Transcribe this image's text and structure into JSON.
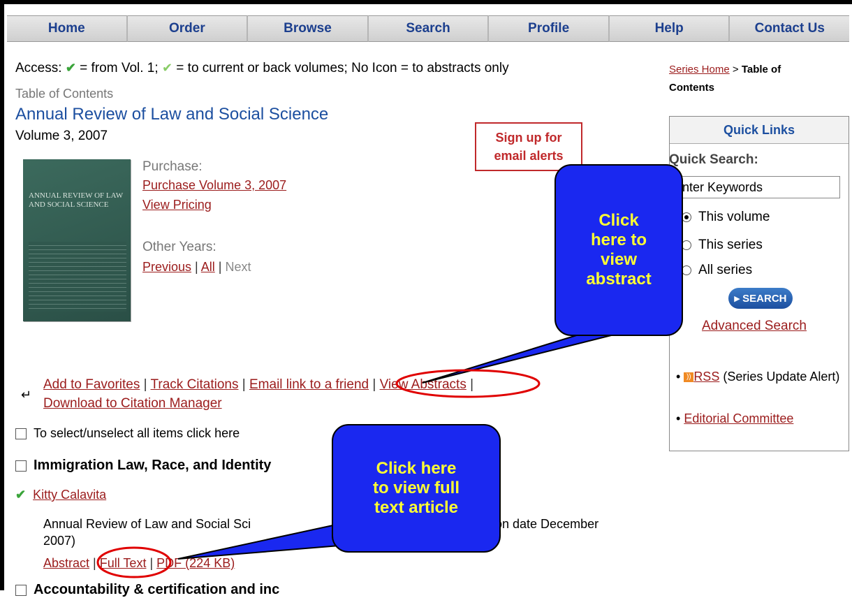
{
  "nav": {
    "items": [
      "Home",
      "Order",
      "Browse",
      "Search",
      "Profile",
      "Help",
      "Contact Us"
    ]
  },
  "access": {
    "prefix": "Access:",
    "check_full": "✔",
    "check_partial": "✔",
    "text1": " = from Vol. 1; ",
    "text2": " = to current or back volumes; No Icon = to abstracts only"
  },
  "page": {
    "toc_label": "Table of Contents",
    "series_title": "Annual Review of Law and Social Science",
    "volume": "Volume 3, 2007",
    "cover_title": "ANNUAL REVIEW OF LAW AND SOCIAL SCIENCE"
  },
  "purchase": {
    "heading": "Purchase:",
    "link1": "Purchase Volume 3, 2007",
    "link2": "View Pricing"
  },
  "other_years": {
    "heading": "Other Years:",
    "previous": "Previous",
    "all": "All",
    "next": "Next",
    "sep": "|"
  },
  "signup": {
    "line1": "Sign up for",
    "line2": "email alerts"
  },
  "tools": {
    "icon": "↵",
    "add_favorites": "Add to Favorites",
    "track_citations": "Track Citations",
    "email_link": "Email link to a friend",
    "view_abstracts": "View Abstracts",
    "download": "Download to Citation Manager",
    "sep": " | "
  },
  "list": {
    "select_all": "To select/unselect all items click here",
    "article_title": "Immigration Law, Race, and Identity",
    "author": "Kitty Calavita",
    "citation_part1": "Annual Review of Law and Social Sci",
    "citation_part2": "tion date December",
    "citation_line2": "2007)",
    "abstract": "Abstract",
    "full_text": "Full Text",
    "pdf": "PDF (224 KB)",
    "next_article": "Accountability & certification and inc"
  },
  "right": {
    "breadcrumb_link": "Series Home",
    "breadcrumb_sep": " > ",
    "breadcrumb_current_1": "Table of",
    "breadcrumb_current_2": "Contents",
    "quick_links": "Quick Links",
    "quick_search": "Quick Search:",
    "search_value": "Enter Keywords",
    "radio_volume": "This volume",
    "radio_series": "This series",
    "radio_all": "All series",
    "search_button": "▸ SEARCH",
    "advanced": "Advanced Search",
    "rss_icon": "RSS",
    "rss_link": "RSS",
    "rss_text": " (Series Update Alert)",
    "editorial": "Editorial Committee"
  },
  "callouts": {
    "abstract_lines": [
      "Click",
      "here to",
      "view",
      "abstract"
    ],
    "fulltext_lines": [
      "Click here",
      "to view full",
      "text article"
    ]
  },
  "colors": {
    "nav_text": "#1c3f8e",
    "link": "#9b1c1c",
    "callout_bg": "#1a28f0",
    "callout_text": "#ffff33",
    "highlight_ellipse": "#e00000"
  }
}
